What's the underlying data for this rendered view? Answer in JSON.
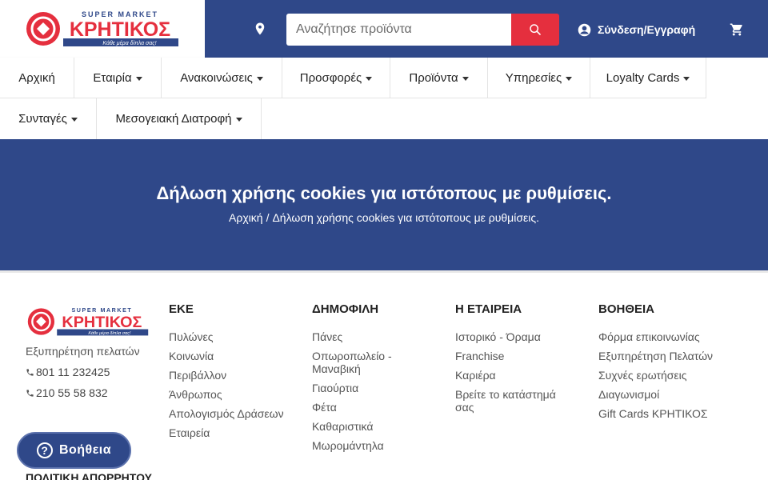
{
  "header": {
    "logo": {
      "top_text": "SUPER MARKET",
      "brand": "ΚΡΗΤΙΚΟΣ",
      "slogan": "Κάθε μέρα δίπλα σας!"
    },
    "search": {
      "placeholder": "Αναζήτησε προϊόντα"
    },
    "login_label": "Σύνδεση/Εγγραφή",
    "icons": [
      "location-pin-icon",
      "search-icon",
      "user-circle-icon",
      "cart-icon"
    ],
    "colors": {
      "header_bg": "#2f4889",
      "search_btn": "#e52f3e"
    }
  },
  "nav": {
    "items": [
      {
        "label": "Αρχική",
        "dropdown": false
      },
      {
        "label": "Εταιρία",
        "dropdown": true
      },
      {
        "label": "Ανακοινώσεις",
        "dropdown": true
      },
      {
        "label": "Προσφορές",
        "dropdown": true
      },
      {
        "label": "Προϊόντα",
        "dropdown": true
      },
      {
        "label": "Υπηρεσίες",
        "dropdown": true
      },
      {
        "label": "Loyalty Cards",
        "dropdown": true
      },
      {
        "label": "Συνταγές",
        "dropdown": true
      },
      {
        "label": "Μεσογειακή Διατροφή",
        "dropdown": true
      }
    ]
  },
  "hero": {
    "title": "Δήλωση χρήσης cookies για ιστότοπους με ρυθμίσεις.",
    "breadcrumb": {
      "home": "Αρχική",
      "separator": "/",
      "current": "Δήλωση χρήσης cookies για ιστότοπους με ρυθμίσεις."
    }
  },
  "footer": {
    "customer_service": "Εξυπηρέτηση πελατών",
    "phones": [
      "801 11 232425",
      "210 55 58 832"
    ],
    "columns": [
      {
        "title": "ΕΚΕ",
        "links": [
          "Πυλώνες",
          "Κοινωνία",
          "Περιβάλλον",
          "Άνθρωπος",
          "Απολογισμός Δράσεων",
          "Εταιρεία"
        ]
      },
      {
        "title": "ΔΗΜΟΦΙΛΗ",
        "links": [
          "Πάνες",
          "Οπωροπωλείο - Μαναβική",
          "Γιαούρτια",
          "Φέτα",
          "Καθαριστικά",
          "Μωρομάντηλα"
        ]
      },
      {
        "title": "Η ΕΤΑΙΡΕΙΑ",
        "links": [
          "Ιστορικό - Όραμα",
          "Franchise",
          "Καριέρα",
          "Βρείτε το κατάστημά σας"
        ]
      },
      {
        "title": "ΒΟΗΘΕΙΑ",
        "links": [
          "Φόρμα επικοινωνίας",
          "Εξυπηρέτηση Πελατών",
          "Συχνές ερωτήσεις",
          "Διαγωνισμοί",
          "Gift Cards ΚΡΗΤΙΚΟΣ"
        ]
      }
    ],
    "policy_title": "ΠΟΛΙΤΙΚΗ ΑΠΟΡΡΗΤΟΥ"
  },
  "help_button": {
    "label": "Βοήθεια"
  }
}
